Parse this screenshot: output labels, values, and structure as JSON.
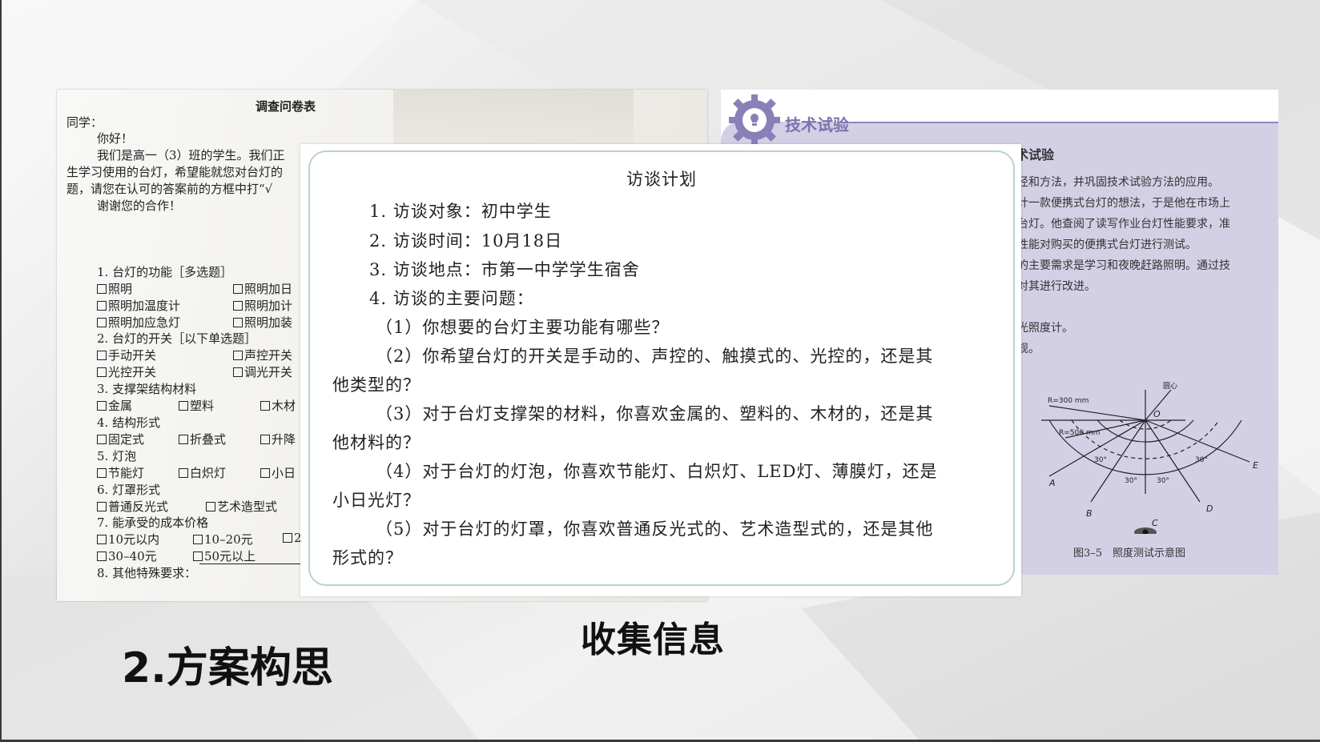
{
  "questionnaire": {
    "title": "调查问卷表",
    "greeting": "同学：",
    "hello": "你好！",
    "intro": [
      "我们是高一（3）班的学生。我们正",
      "生学习使用的台灯，希望能就您对台灯的",
      "题，请您在认可的答案前的方框中打“√",
      "谢谢您的合作！"
    ],
    "q1": {
      "label": "1. 台灯的功能［多选题］",
      "options": [
        "照明",
        "照明加日",
        "照明加温度计",
        "照明加计",
        "照明加应急灯",
        "照明加装"
      ]
    },
    "q2": {
      "label": "2. 台灯的开关［以下单选题］",
      "options": [
        "手动开关",
        "声控开关",
        "光控开关",
        "调光开关"
      ]
    },
    "q3": {
      "label": "3. 支撑架结构材料",
      "options": [
        "金属",
        "塑料",
        "木材"
      ]
    },
    "q4": {
      "label": "4. 结构形式",
      "options": [
        "固定式",
        "折叠式",
        "升降"
      ]
    },
    "q5": {
      "label": "5. 灯泡",
      "options": [
        "节能灯",
        "白炽灯",
        "小日"
      ]
    },
    "q6": {
      "label": "6. 灯罩形式",
      "options": [
        "普通反光式",
        "艺术造型式"
      ]
    },
    "q7": {
      "label": "7. 能承受的成本价格",
      "options": [
        "10元以内",
        "10–20元",
        "2",
        "30–40元",
        "50元以上"
      ]
    },
    "q8": {
      "label": "8. 其他特殊要求："
    }
  },
  "tech_experiment": {
    "title": "技术试验",
    "subtitle": "术试验",
    "lines": [
      "径和方法，并巩固技术试验方法的应用。",
      "计一款便携式台灯的想法，于是他在市场上",
      "台灯。他查阅了读写作业台灯性能要求，准",
      "性能对购买的便携式台灯进行测试。",
      "的主要需求是学习和夜晚赶路照明。通过技",
      "对其进行改进。",
      "光照度计。",
      "规。"
    ],
    "diagram": {
      "center_label": "圆心",
      "o": "O",
      "r300": "R=300 mm",
      "r500": "R=500 mm",
      "points": [
        "A",
        "B",
        "C",
        "D",
        "E"
      ],
      "angles": [
        "30°",
        "30°",
        "30°",
        "30°"
      ]
    },
    "caption": "图3–5　照度测试示意图"
  },
  "interview_plan": {
    "title": "访谈计划",
    "items": [
      "1. 访谈对象：初中学生",
      "2. 访谈时间：10月18日",
      "3. 访谈地点：市第一中学学生宿舍",
      "4. 访谈的主要问题："
    ],
    "questions": [
      "（1）你想要的台灯主要功能有哪些？",
      "（2）你希望台灯的开关是手动的、声控的、触摸式的、光控的，还是其",
      "他类型的？",
      "（3）对于台灯支撑架的材料，你喜欢金属的、塑料的、木材的，还是其",
      "他材料的？",
      "（4）对于台灯的灯泡，你喜欢节能灯、白炽灯、LED灯、薄膜灯，还是",
      "小日光灯？",
      "（5）对于台灯的灯罩，你喜欢普通反光式的、艺术造型式的，还是其他",
      "形式的？"
    ]
  },
  "labels": {
    "collect": "收集信息",
    "section": "2.方案构思"
  }
}
